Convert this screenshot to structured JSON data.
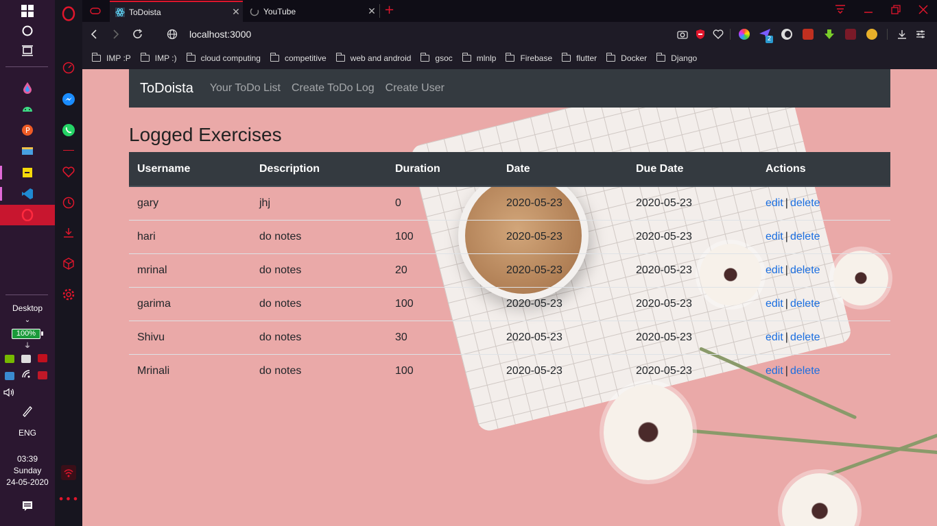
{
  "taskbar": {
    "desktop_label": "Desktop",
    "battery": "100%",
    "language": "ENG",
    "time": "03:39",
    "day": "Sunday",
    "date": "24-05-2020",
    "icons": [
      "windows-start-icon",
      "search-circle-icon",
      "task-view-icon",
      "paint-drop-icon",
      "android-icon",
      "postman-icon",
      "file-explorer-icon",
      "sticky-notes-icon",
      "vscode-icon",
      "opera-icon",
      "nvidia-icon",
      "battery-icon",
      "shield-icon",
      "network-icon",
      "wifi-icon",
      "mcafee-icon",
      "volume-icon",
      "pen-icon",
      "notifications-icon"
    ]
  },
  "opera_sidebar": {
    "icons": [
      "opera-logo-icon",
      "speed-dial-icon",
      "messenger-icon",
      "whatsapp-icon",
      "heart-icon",
      "history-icon",
      "download-icon",
      "cube-icon",
      "settings-gear-icon",
      "vpn-icon",
      "more-dots-icon"
    ]
  },
  "browser": {
    "tabs": [
      {
        "title": "ToDoista",
        "active": true
      },
      {
        "title": "YouTube",
        "active": false
      }
    ],
    "url": "localhost:3000",
    "bookmarks": [
      "IMP :P",
      "IMP :)",
      "cloud computing",
      "competitive",
      "web and android",
      "gsoc",
      "mlnlp",
      "Firebase",
      "flutter",
      "Docker",
      "Django"
    ],
    "extension_badge": "2"
  },
  "app": {
    "brand": "ToDoista",
    "nav": [
      "Your ToDo List",
      "Create ToDo Log",
      "Create User"
    ],
    "heading": "Logged Exercises",
    "columns": [
      "Username",
      "Description",
      "Duration",
      "Date",
      "Due Date",
      "Actions"
    ],
    "rows": [
      {
        "username": "gary",
        "description": "jhj",
        "duration": "0",
        "date": "2020-05-23",
        "due_date": "2020-05-23"
      },
      {
        "username": "hari",
        "description": "do notes",
        "duration": "100",
        "date": "2020-05-23",
        "due_date": "2020-05-23"
      },
      {
        "username": "mrinal",
        "description": "do notes",
        "duration": "20",
        "date": "2020-05-23",
        "due_date": "2020-05-23"
      },
      {
        "username": "garima",
        "description": "do notes",
        "duration": "100",
        "date": "2020-05-23",
        "due_date": "2020-05-23"
      },
      {
        "username": "Shivu",
        "description": "do notes",
        "duration": "30",
        "date": "2020-05-23",
        "due_date": "2020-05-23"
      },
      {
        "username": "Mrinali",
        "description": "do notes",
        "duration": "100",
        "date": "2020-05-23",
        "due_date": "2020-05-23"
      }
    ],
    "actions": {
      "edit": "edit",
      "separator": "|",
      "delete": "delete"
    }
  },
  "colors": {
    "navbar": "#343a40",
    "link": "#1a6ee0",
    "opera_red": "#e0162c",
    "page_bg": "#eaa9a8"
  }
}
